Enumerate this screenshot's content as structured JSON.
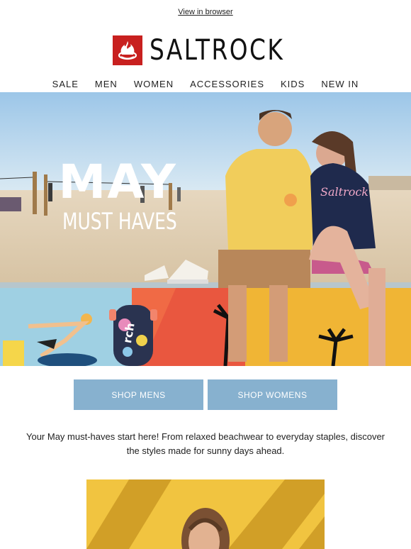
{
  "header": {
    "view_in_browser": "View in browser",
    "brand": "SALTROCK"
  },
  "nav": {
    "items": [
      "SALE",
      "MEN",
      "WOMEN",
      "ACCESSORIES",
      "KIDS",
      "NEW IN"
    ]
  },
  "hero": {
    "headline": "MAY",
    "subheadline": "MUST HAVES",
    "board_text": "rch"
  },
  "cta": {
    "mens": "SHOP MENS",
    "womens": "SHOP WOMENS"
  },
  "body_copy": {
    "line1": "Your May must-haves start here! From relaxed beachwear to everyday staples, discover",
    "line2": "the styles made for sunny days ahead."
  },
  "colors": {
    "brand_red": "#c8201f",
    "button_blue": "#87b1cf",
    "hoodie_yellow": "#f1cd5b",
    "hoodie_navy": "#1f2a4d"
  },
  "icons": {
    "logo": "flame-sun-icon"
  }
}
